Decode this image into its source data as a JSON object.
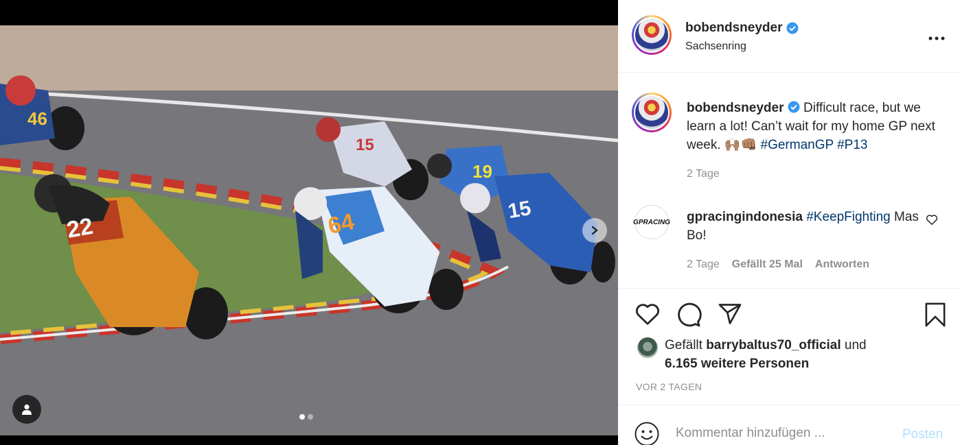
{
  "post": {
    "username": "bobendsneyder",
    "location": "Sachsenring",
    "caption_text": "Difficult race, but we learn a lot! Can’t wait for my home GP next week. 🙌🏽👊🏽",
    "caption_tags": [
      "#GermanGP",
      "#P13"
    ],
    "caption_time": "2 Tage",
    "image_bikes": [
      "22",
      "64",
      "15",
      "15",
      "19"
    ]
  },
  "comment": {
    "username": "gpracingindonesia",
    "tag": "#KeepFighting",
    "text": "Mas Bo!",
    "time": "2 Tage",
    "likes": "Gefällt 25 Mal",
    "reply": "Antworten",
    "avatar_text": "GPRACING"
  },
  "likes": {
    "prefix": "Gefällt",
    "user": "barrybaltus70_official",
    "mid": "und",
    "others": "6.165 weitere Personen"
  },
  "posted_ago": "VOR 2 TAGEN",
  "input": {
    "placeholder": "Kommentar hinzufügen ...",
    "post_label": "Posten"
  },
  "colors": {
    "link": "#00376b",
    "verified": "#3897f0",
    "muted": "#8e8e8e",
    "post_disabled": "#b2dffc"
  },
  "icons": [
    "verified-icon",
    "more-icon",
    "heart-icon",
    "comment-icon",
    "share-icon",
    "bookmark-icon",
    "emoji-icon",
    "user-tag-icon",
    "chevron-right-icon"
  ]
}
